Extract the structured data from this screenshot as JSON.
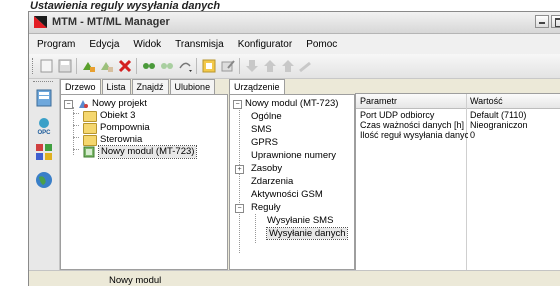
{
  "heading": "Ustawienia reguly wysyłania danych",
  "window": {
    "title": "MTM - MT/ML Manager"
  },
  "menu": [
    "Program",
    "Edycja",
    "Widok",
    "Transmisja",
    "Konfigurator",
    "Pomoc"
  ],
  "toolbar_icons": [
    "new-icon",
    "save-icon",
    "connect-icon",
    "disconnect-icon",
    "delete-icon",
    "sync-icon",
    "sync-alt-icon",
    "arrow-dropdown-icon",
    "open-icon",
    "edit-icon",
    "download-icon",
    "upload-icon",
    "upload-alt-icon",
    "pencil-icon"
  ],
  "left_strip_icons": [
    "project-icon",
    "opc-icon",
    "modules-icon",
    "globe-icon"
  ],
  "left_panel": {
    "tabs": [
      "Drzewo",
      "Lista",
      "Znajdź",
      "Ulubione"
    ],
    "active_tab": "Drzewo",
    "tree": {
      "root": "Nowy projekt",
      "children": [
        "Obiekt 3",
        "Pompownia",
        "Sterownia",
        "Nowy modul (MT-723)"
      ]
    }
  },
  "middle_panel": {
    "tab": "Urządzenie",
    "tree": {
      "root": "Nowy modul (MT-723)",
      "items": [
        "Ogólne",
        "SMS",
        "GPRS",
        "Uprawnione numery",
        "Zasoby",
        "Zdarzenia",
        "Aktywności GSM",
        "Reguły"
      ],
      "rules": [
        "Wysyłanie SMS",
        "Wysyłanie danych"
      ]
    }
  },
  "grid": {
    "headers": [
      "Parametr",
      "Wartość"
    ],
    "rows": [
      {
        "param": "Port UDP odbiorcy",
        "value": "Default (7110)"
      },
      {
        "param": "Czas ważności danych [h]",
        "value": "Nieograniczon"
      },
      {
        "param": "Ilość reguł wysyłania danych",
        "value": "0"
      }
    ]
  },
  "status": "Nowy modul",
  "colors": {
    "window_bg": "#ece9d8",
    "title_icon": "#e31e24",
    "folder": "#f5d76e"
  }
}
